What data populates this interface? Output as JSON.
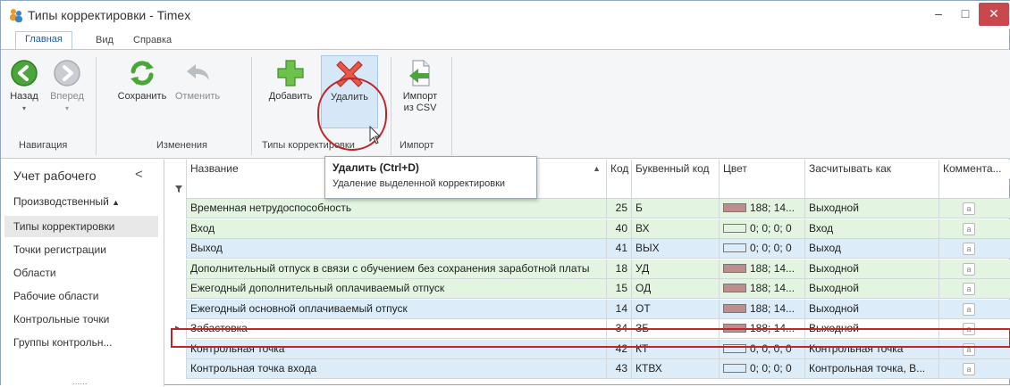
{
  "window": {
    "title": "Типы корректировки - Timex",
    "min_symbol": "–",
    "max_symbol": "□",
    "close_symbol": "✕"
  },
  "ribbon_tabs": [
    "Главная",
    "Вид",
    "Справка"
  ],
  "ribbon": {
    "back": "Назад",
    "forward": "Вперед",
    "save": "Сохранить",
    "undo": "Отменить",
    "add": "Добавить",
    "delete": "Удалить",
    "import_line1": "Импорт",
    "import_line2": "из CSV",
    "groups": {
      "navigation": "Навигация",
      "changes": "Изменения",
      "types": "Типы корректировки",
      "import": "Импорт"
    }
  },
  "tooltip": {
    "title": "Удалить (Ctrl+D)",
    "text": "Удаление выделенной корректировки"
  },
  "nav": {
    "header": "Учет рабочего",
    "collapse": "<",
    "items": [
      "Производственный",
      "Типы корректировки",
      "Точки регистрации",
      "Области",
      "Рабочие области",
      "Контрольные точки",
      "Группы контрольн..."
    ],
    "dots": "......"
  },
  "grid": {
    "columns": [
      "Название",
      "Код",
      "Буквенный код",
      "Цвет",
      "Засчитывать как",
      "Коммента..."
    ],
    "filter_icon": "funnel-icon",
    "rows": [
      {
        "name": "Временная нетрудоспособность",
        "code": "25",
        "letter": "Б",
        "color": "188; 14...",
        "swatch": "#bc8e8e",
        "count_as": "Выходной",
        "bg": "#e3f5e1"
      },
      {
        "name": "Вход",
        "code": "40",
        "letter": "ВХ",
        "color": "0; 0; 0; 0",
        "swatch": "transparent",
        "count_as": "Вход",
        "bg": "#e3f5e1"
      },
      {
        "name": "Выход",
        "code": "41",
        "letter": "ВЫХ",
        "color": "0; 0; 0; 0",
        "swatch": "transparent",
        "count_as": "Выход",
        "bg": "#dcecf8"
      },
      {
        "name": "Дополнительный отпуск в связи с обучением без сохранения заработной платы",
        "code": "18",
        "letter": "УД",
        "color": "188; 14...",
        "swatch": "#bc8e8e",
        "count_as": "Выходной",
        "bg": "#e3f5e1"
      },
      {
        "name": "Ежегодный дополнительный оплачиваемый отпуск",
        "code": "15",
        "letter": "ОД",
        "color": "188; 14...",
        "swatch": "#bc8e8e",
        "count_as": "Выходной",
        "bg": "#e3f5e1"
      },
      {
        "name": "Ежегодный основной оплачиваемый отпуск",
        "code": "14",
        "letter": "ОТ",
        "color": "188; 14...",
        "swatch": "#bc8e8e",
        "count_as": "Выходной",
        "bg": "#dcecf8"
      },
      {
        "name": "Забастовка",
        "code": "34",
        "letter": "ЗБ",
        "color": "188; 14...",
        "swatch": "#bc8e8e",
        "count_as": "Выходной",
        "bg": "#ffffff"
      },
      {
        "name": "Контрольная точка",
        "code": "42",
        "letter": "КТ",
        "color": "0; 0; 0; 0",
        "swatch": "transparent",
        "count_as": "Контрольная точка",
        "bg": "#dcecf8"
      },
      {
        "name": "Контрольная точка входа",
        "code": "43",
        "letter": "КТВХ",
        "color": "0; 0; 0; 0",
        "swatch": "transparent",
        "count_as": "Контрольная точка, В...",
        "bg": "#dcecf8"
      }
    ],
    "comment_glyph": "a",
    "current_row_marker": "▸"
  },
  "colors": {
    "accent": "#1f5ea6",
    "highlight_red": "#c0252b",
    "close_red": "#c9484d"
  }
}
